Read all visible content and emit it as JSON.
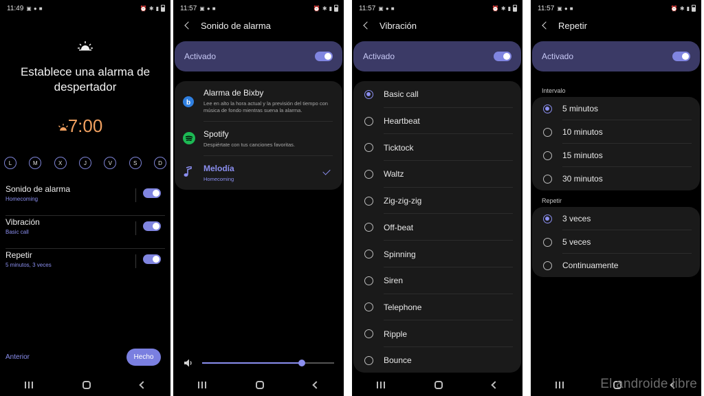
{
  "screens": [
    {
      "status_time": "11:49",
      "title": "Establece una alarma de despertador",
      "alarm_time": "7:00",
      "days": [
        "L",
        "M",
        "X",
        "J",
        "V",
        "S",
        "D"
      ],
      "settings": [
        {
          "label": "Sonido de alarma",
          "sub": "Homecoming",
          "enabled": true
        },
        {
          "label": "Vibración",
          "sub": "Basic call",
          "enabled": true
        },
        {
          "label": "Repetir",
          "sub": "5 minutos, 3 veces",
          "enabled": true
        }
      ],
      "prev_label": "Anterior",
      "done_label": "Hecho"
    },
    {
      "status_time": "11:57",
      "header_title": "Sonido de alarma",
      "activado_label": "Activado",
      "activado_on": true,
      "sources": [
        {
          "name": "Alarma de Bixby",
          "desc": "Lee en alto la hora actual y la previsión del tiempo con música de fondo mientras suena la alarma.",
          "icon": "bixby-icon"
        },
        {
          "name": "Spotify",
          "desc": "Despiértate con tus canciones favoritas.",
          "icon": "spotify-icon"
        },
        {
          "name": "Melodía",
          "desc": "Homecoming",
          "icon": "music-note-icon",
          "selected": true
        }
      ],
      "volume": 0.73
    },
    {
      "status_time": "11:57",
      "header_title": "Vibración",
      "activado_label": "Activado",
      "activado_on": true,
      "options": [
        "Basic call",
        "Heartbeat",
        "Ticktock",
        "Waltz",
        "Zig-zig-zig",
        "Off-beat",
        "Spinning",
        "Siren",
        "Telephone",
        "Ripple",
        "Bounce"
      ],
      "selected_index": 0
    },
    {
      "status_time": "11:57",
      "header_title": "Repetir",
      "activado_label": "Activado",
      "activado_on": true,
      "interval_label": "Intervalo",
      "intervals": [
        "5 minutos",
        "10 minutos",
        "15 minutos",
        "30 minutos"
      ],
      "interval_selected": 0,
      "repeat_label": "Repetir",
      "repeats": [
        "3 veces",
        "5 veces",
        "Continuamente"
      ],
      "repeat_selected": 0
    }
  ],
  "watermark": "El androide libre",
  "colors": {
    "accent": "#8b8ff0",
    "activado_bg": "#3b3a66",
    "card_bg": "#1a1a1a",
    "time_color": "#f0a060"
  }
}
